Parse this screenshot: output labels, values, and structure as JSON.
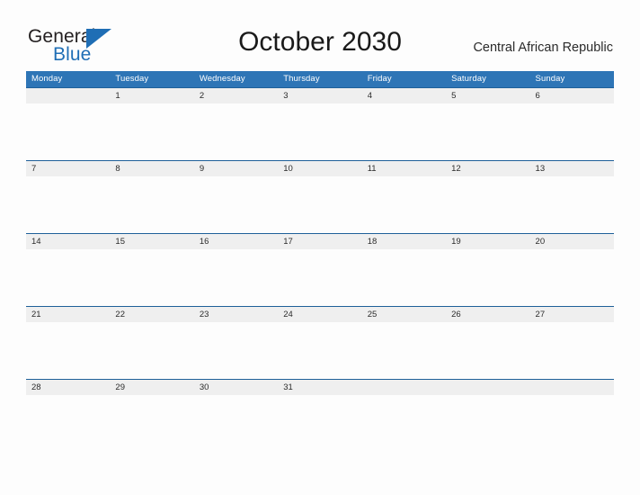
{
  "brand": {
    "name_part1": "General",
    "name_part2": "Blue",
    "triangle_icon": "triangle-icon",
    "accent_color": "#1f6eb5"
  },
  "header": {
    "month_title": "October 2030",
    "country": "Central African Republic"
  },
  "colors": {
    "weekday_header_bg": "#2e75b6",
    "row_divider": "#1f6099",
    "day_band_bg": "#efefef",
    "page_bg": "#fdfdfd",
    "text": "#2b2b2b"
  },
  "calendar": {
    "weekdays": [
      "Monday",
      "Tuesday",
      "Wednesday",
      "Thursday",
      "Friday",
      "Saturday",
      "Sunday"
    ],
    "weeks": [
      [
        "",
        "1",
        "2",
        "3",
        "4",
        "5",
        "6"
      ],
      [
        "7",
        "8",
        "9",
        "10",
        "11",
        "12",
        "13"
      ],
      [
        "14",
        "15",
        "16",
        "17",
        "18",
        "19",
        "20"
      ],
      [
        "21",
        "22",
        "23",
        "24",
        "25",
        "26",
        "27"
      ],
      [
        "28",
        "29",
        "30",
        "31",
        "",
        "",
        ""
      ]
    ]
  }
}
